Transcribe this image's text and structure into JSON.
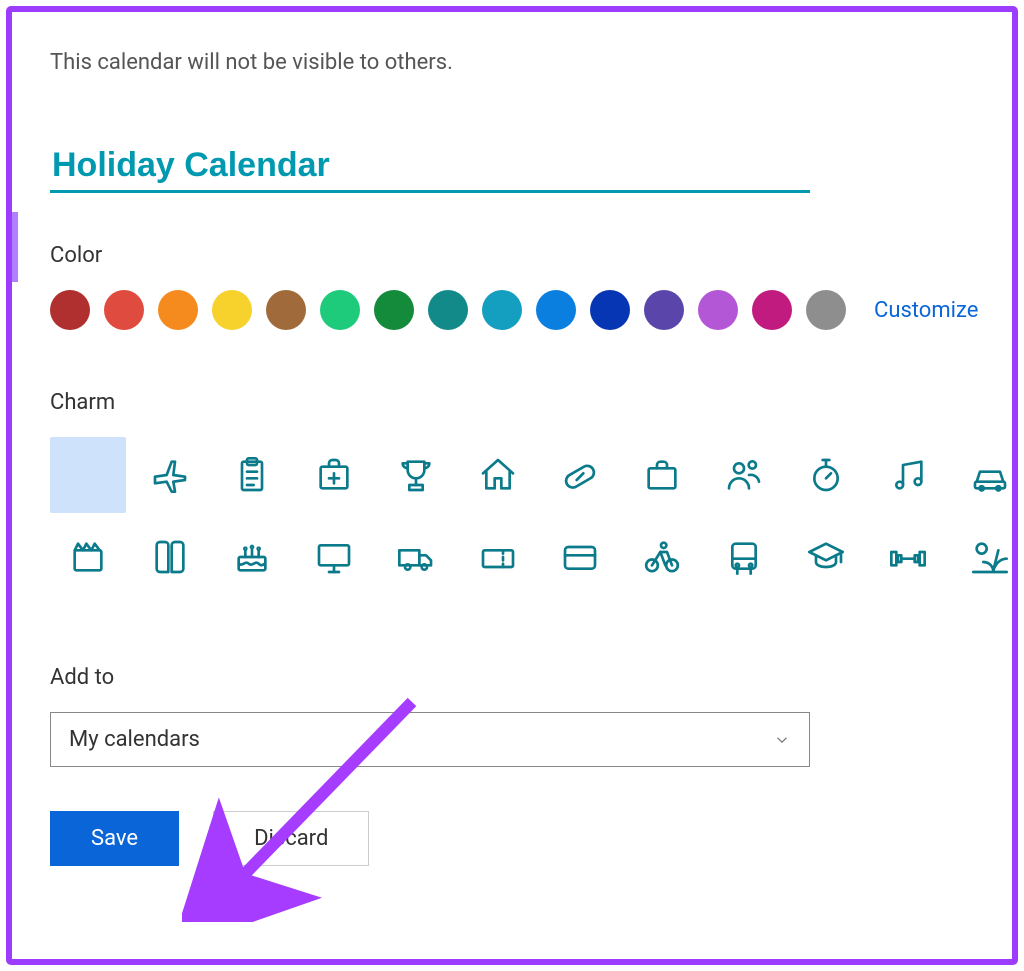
{
  "info_text": "This calendar will not be visible to others.",
  "calendar_name": "Holiday Calendar",
  "color_label": "Color",
  "colors": [
    "#b03030",
    "#e04b3f",
    "#f58a1f",
    "#f7d22d",
    "#a06a3a",
    "#1ecb7a",
    "#148a3b",
    "#128a8a",
    "#149ebf",
    "#0b7fe0",
    "#0736b4",
    "#5a46ab",
    "#b357d6",
    "#c21b7f",
    "#8e8e8e"
  ],
  "customize_label": "Customize",
  "charm_label": "Charm",
  "charms": [
    "none",
    "airplane",
    "clipboard",
    "first-aid",
    "trophy",
    "home",
    "pill",
    "briefcase",
    "people",
    "stopwatch",
    "music",
    "car",
    "movie",
    "book",
    "cake",
    "monitor",
    "truck",
    "ticket",
    "credit-card",
    "bicycle",
    "bus",
    "graduation",
    "dumbbell",
    "vacation"
  ],
  "selected_charm": 0,
  "addto_label": "Add to",
  "addto_value": "My calendars",
  "save_label": "Save",
  "discard_label": "Discard"
}
